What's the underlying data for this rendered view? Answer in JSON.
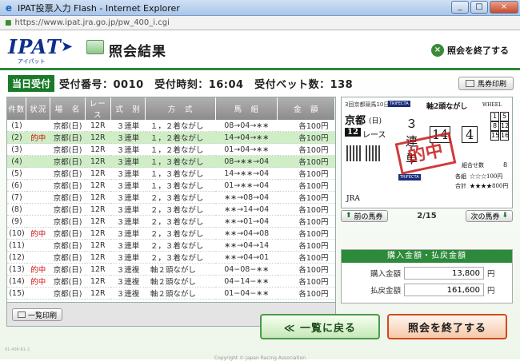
{
  "window": {
    "title": "IPAT投票入力 Flash - Internet Explorer",
    "address": "https://www.ipat.jra.go.jp/pw_400_i.cgi",
    "min_label": "_",
    "max_label": "□",
    "close_label": "×"
  },
  "header": {
    "logo": "IPAT",
    "logo_sub": "アイパット",
    "page_title": "照会結果",
    "end_link_icon": "×",
    "end_link": "照会を終了する"
  },
  "info": {
    "badge": "当日受付",
    "text": "受付番号：0010　受付時刻：16:04　受付ベット数：138",
    "print_label": "馬券印刷"
  },
  "table": {
    "headers": [
      "件数",
      "状況",
      "場　名",
      "レース",
      "式　別",
      "方　式",
      "馬　組",
      "金　額"
    ],
    "rows": [
      {
        "n": "(1)",
        "st": "",
        "pl": "京都(日)",
        "rc": "12R",
        "sh": "３連単",
        "hs": "１，２着ながし",
        "km": "08→04→∗∗",
        "am": "各100円",
        "hi": false
      },
      {
        "n": "(2)",
        "st": "的中",
        "pl": "京都(日)",
        "rc": "12R",
        "sh": "３連単",
        "hs": "１，２着ながし",
        "km": "14→04→∗∗",
        "am": "各100円",
        "hi": true
      },
      {
        "n": "(3)",
        "st": "",
        "pl": "京都(日)",
        "rc": "12R",
        "sh": "３連単",
        "hs": "１，２着ながし",
        "km": "01→04→∗∗",
        "am": "各100円",
        "hi": false
      },
      {
        "n": "(4)",
        "st": "",
        "pl": "京都(日)",
        "rc": "12R",
        "sh": "３連単",
        "hs": "１，３着ながし",
        "km": "08→∗∗→04",
        "am": "各100円",
        "hi": true
      },
      {
        "n": "(5)",
        "st": "",
        "pl": "京都(日)",
        "rc": "12R",
        "sh": "３連単",
        "hs": "１，３着ながし",
        "km": "14→∗∗→04",
        "am": "各100円",
        "hi": false
      },
      {
        "n": "(6)",
        "st": "",
        "pl": "京都(日)",
        "rc": "12R",
        "sh": "３連単",
        "hs": "１，３着ながし",
        "km": "01→∗∗→04",
        "am": "各100円",
        "hi": false
      },
      {
        "n": "(7)",
        "st": "",
        "pl": "京都(日)",
        "rc": "12R",
        "sh": "３連単",
        "hs": "２，３着ながし",
        "km": "∗∗→08→04",
        "am": "各100円",
        "hi": false
      },
      {
        "n": "(8)",
        "st": "",
        "pl": "京都(日)",
        "rc": "12R",
        "sh": "３連単",
        "hs": "２，３着ながし",
        "km": "∗∗→14→04",
        "am": "各100円",
        "hi": false
      },
      {
        "n": "(9)",
        "st": "",
        "pl": "京都(日)",
        "rc": "12R",
        "sh": "３連単",
        "hs": "２，３着ながし",
        "km": "∗∗→01→04",
        "am": "各100円",
        "hi": false
      },
      {
        "n": "(10)",
        "st": "的中",
        "pl": "京都(日)",
        "rc": "12R",
        "sh": "３連単",
        "hs": "２，３着ながし",
        "km": "∗∗→04→08",
        "am": "各100円",
        "hi": false
      },
      {
        "n": "(11)",
        "st": "",
        "pl": "京都(日)",
        "rc": "12R",
        "sh": "３連単",
        "hs": "２，３着ながし",
        "km": "∗∗→04→14",
        "am": "各100円",
        "hi": false
      },
      {
        "n": "(12)",
        "st": "",
        "pl": "京都(日)",
        "rc": "12R",
        "sh": "３連単",
        "hs": "２，３着ながし",
        "km": "∗∗→04→01",
        "am": "各100円",
        "hi": false
      },
      {
        "n": "(13)",
        "st": "的中",
        "pl": "京都(日)",
        "rc": "12R",
        "sh": "３連複",
        "hs": "軸２頭ながし",
        "km": "04−08−∗∗",
        "am": "各100円",
        "hi": false
      },
      {
        "n": "(14)",
        "st": "的中",
        "pl": "京都(日)",
        "rc": "12R",
        "sh": "３連複",
        "hs": "軸２頭ながし",
        "km": "04−14−∗∗",
        "am": "各100円",
        "hi": false
      },
      {
        "n": "(15)",
        "st": "",
        "pl": "京都(日)",
        "rc": "12R",
        "sh": "３連複",
        "hs": "軸２頭ながし",
        "km": "01−04−∗∗",
        "am": "各100円",
        "hi": false
      }
    ],
    "list_print_label": "一覧印刷"
  },
  "ticket": {
    "header": "3回京都競馬10日",
    "trifecta": "TRIFECTA",
    "place": "京都",
    "day": "(日)",
    "race_no": "12",
    "race_label": "レース",
    "kind_chars": [
      "３",
      "連",
      "単"
    ],
    "mode": "軸2頭ながし",
    "mode_en": "WHEEL",
    "axis1": "14",
    "axis2": "4",
    "partners": [
      "1",
      "5",
      "8",
      "12",
      "15",
      "16"
    ],
    "combo_label": "組合せ数",
    "combo_count": "8",
    "each_label": "各組",
    "each_value": "☆☆☆100円",
    "total_label": "合計",
    "total_value": "★★★★800円",
    "stamp": "的中",
    "jra": "JRA"
  },
  "nav": {
    "prev_icon": "⬆",
    "prev": "前の馬券",
    "page": "2/15",
    "next": "次の馬券",
    "next_icon": "⬇"
  },
  "kin": {
    "title": "購入金額・払戻金額",
    "purchase_label": "購入金額",
    "purchase_value": "13,800",
    "payout_label": "払戻金額",
    "payout_value": "161,600",
    "unit": "円"
  },
  "buttons": {
    "back": "≪ 一覧に戻る",
    "end": "照会を終了する"
  },
  "footer": {
    "copyright": "Copyright © Japan Racing Association",
    "id": "01-406-R1-2"
  }
}
